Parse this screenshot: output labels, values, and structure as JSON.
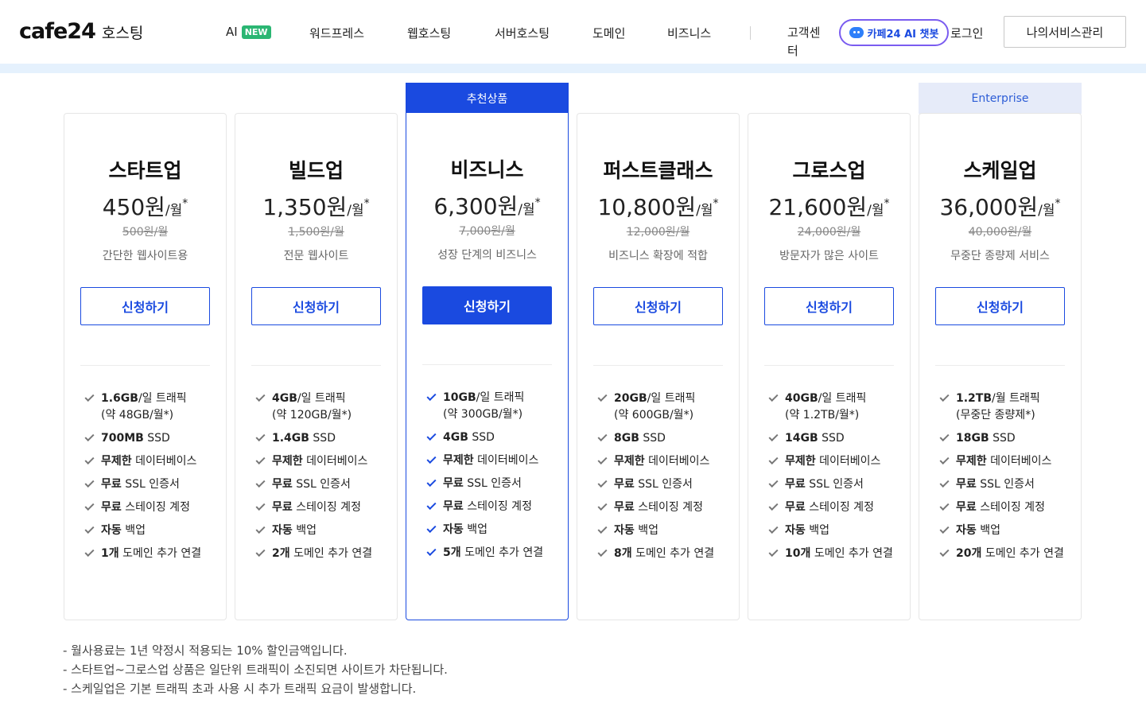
{
  "header": {
    "logo": "cafe24",
    "logo_sub": "호스팅",
    "nav": [
      {
        "label": "AI",
        "badge": "NEW"
      },
      {
        "label": "워드프레스"
      },
      {
        "label": "웹호스팅"
      },
      {
        "label": "서버호스팅"
      },
      {
        "label": "도메인"
      },
      {
        "label": "비즈니스"
      }
    ],
    "support": "고객센터",
    "chatbot": "카페24 AI 챗봇",
    "login": "로그인",
    "mypage": "나의서비스관리"
  },
  "tags": {
    "recommended": "추천상품",
    "enterprise": "Enterprise"
  },
  "plans": [
    {
      "name": "스타트업",
      "price": "450원",
      "unit": "/월",
      "star": "*",
      "old_price": "500원/월",
      "desc": "간단한 웹사이트용",
      "button": "신청하기",
      "features": [
        {
          "bold": "1.6GB",
          "rest": "/일 트래픽",
          "sub": "(약 48GB/월*)"
        },
        {
          "bold": "700MB",
          "rest": " SSD"
        },
        {
          "bold": "무제한",
          "rest": " 데이터베이스"
        },
        {
          "bold": "무료",
          "rest": " SSL 인증서"
        },
        {
          "bold": "무료",
          "rest": " 스테이징 계정"
        },
        {
          "bold": "자동",
          "rest": " 백업"
        },
        {
          "bold": "1개",
          "rest": " 도메인 추가 연결"
        }
      ]
    },
    {
      "name": "빌드업",
      "price": "1,350원",
      "unit": "/월",
      "star": "*",
      "old_price": "1,500원/월",
      "desc": "전문 웹사이트",
      "button": "신청하기",
      "features": [
        {
          "bold": "4GB",
          "rest": "/일 트래픽",
          "sub": "(약 120GB/월*)"
        },
        {
          "bold": "1.4GB",
          "rest": " SSD"
        },
        {
          "bold": "무제한",
          "rest": " 데이터베이스"
        },
        {
          "bold": "무료",
          "rest": " SSL 인증서"
        },
        {
          "bold": "무료",
          "rest": " 스테이징 계정"
        },
        {
          "bold": "자동",
          "rest": " 백업"
        },
        {
          "bold": "2개",
          "rest": " 도메인 추가 연결"
        }
      ]
    },
    {
      "name": "비즈니스",
      "price": "6,300원",
      "unit": "/월",
      "star": "*",
      "old_price": "7,000원/월",
      "desc": "성장 단계의 비즈니스",
      "button": "신청하기",
      "features": [
        {
          "bold": "10GB",
          "rest": "/일 트래픽",
          "sub": "(약 300GB/월*)"
        },
        {
          "bold": "4GB",
          "rest": " SSD"
        },
        {
          "bold": "무제한",
          "rest": " 데이터베이스"
        },
        {
          "bold": "무료",
          "rest": " SSL 인증서"
        },
        {
          "bold": "무료",
          "rest": " 스테이징 계정"
        },
        {
          "bold": "자동",
          "rest": " 백업"
        },
        {
          "bold": "5개",
          "rest": " 도메인 추가 연결"
        }
      ]
    },
    {
      "name": "퍼스트클래스",
      "price": "10,800원",
      "unit": "/월",
      "star": "*",
      "old_price": "12,000원/월",
      "desc": "비즈니스 확장에 적합",
      "button": "신청하기",
      "features": [
        {
          "bold": "20GB",
          "rest": "/일 트래픽",
          "sub": "(약 600GB/월*)"
        },
        {
          "bold": "8GB",
          "rest": " SSD"
        },
        {
          "bold": "무제한",
          "rest": " 데이터베이스"
        },
        {
          "bold": "무료",
          "rest": " SSL 인증서"
        },
        {
          "bold": "무료",
          "rest": " 스테이징 계정"
        },
        {
          "bold": "자동",
          "rest": " 백업"
        },
        {
          "bold": "8개",
          "rest": " 도메인 추가 연결"
        }
      ]
    },
    {
      "name": "그로스업",
      "price": "21,600원",
      "unit": "/월",
      "star": "*",
      "old_price": "24,000원/월",
      "desc": "방문자가 많은 사이트",
      "button": "신청하기",
      "features": [
        {
          "bold": "40GB",
          "rest": "/일 트래픽",
          "sub": "(약 1.2TB/월*)"
        },
        {
          "bold": "14GB",
          "rest": " SSD"
        },
        {
          "bold": "무제한",
          "rest": " 데이터베이스"
        },
        {
          "bold": "무료",
          "rest": " SSL 인증서"
        },
        {
          "bold": "무료",
          "rest": " 스테이징 계정"
        },
        {
          "bold": "자동",
          "rest": " 백업"
        },
        {
          "bold": "10개",
          "rest": " 도메인 추가 연결"
        }
      ]
    },
    {
      "name": "스케일업",
      "price": "36,000원",
      "unit": "/월",
      "star": "*",
      "old_price": "40,000원/월",
      "desc": "무중단 종량제 서비스",
      "button": "신청하기",
      "features": [
        {
          "bold": "1.2TB",
          "rest": "/월 트래픽",
          "sub": "(무중단 종량제*)"
        },
        {
          "bold": "18GB",
          "rest": " SSD"
        },
        {
          "bold": "무제한",
          "rest": " 데이터베이스"
        },
        {
          "bold": "무료",
          "rest": " SSL 인증서"
        },
        {
          "bold": "무료",
          "rest": " 스테이징 계정"
        },
        {
          "bold": "자동",
          "rest": " 백업"
        },
        {
          "bold": "20개",
          "rest": " 도메인 추가 연결"
        }
      ]
    }
  ],
  "notes": [
    "- 월사용료는 1년 약정시 적용되는 10% 할인금액입니다.",
    "- 스타트업~그로스업 상품은 일단위 트래픽이 소진되면 사이트가 차단됩니다.",
    "- 스케일업은 기본 트래픽 초과 사용 시 추가 트래픽 요금이 발생합니다."
  ],
  "colors": {
    "brand_blue": "#1a4ae0",
    "new_badge": "#2bb673",
    "header_band": "#e5f1fd"
  }
}
